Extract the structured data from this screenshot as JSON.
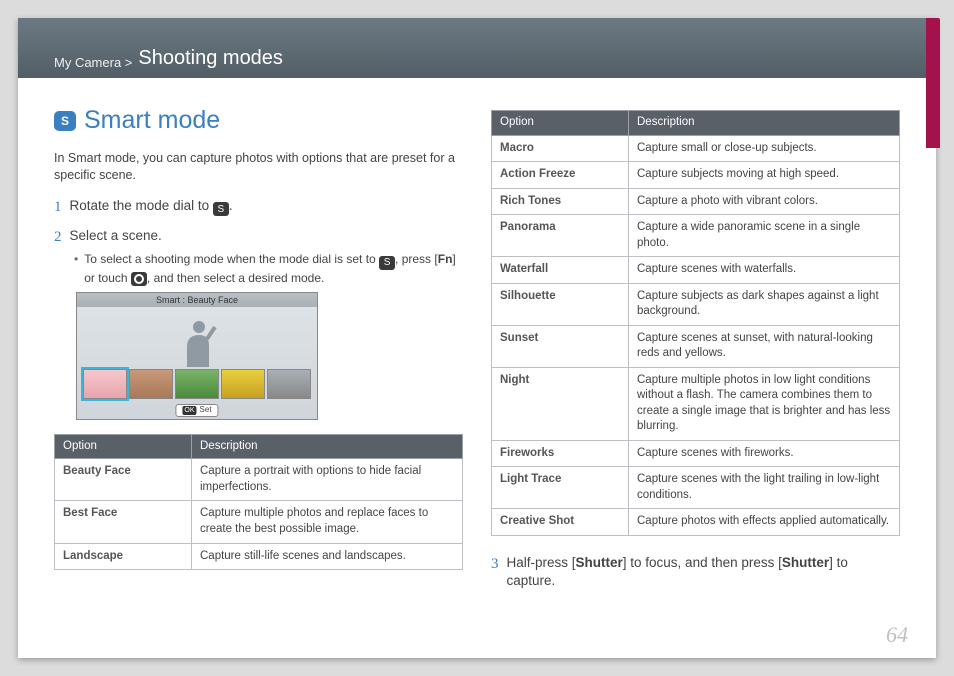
{
  "breadcrumb_prefix": "My Camera >",
  "breadcrumb_title": "Shooting modes",
  "section_title": "Smart mode",
  "section_icon_letter": "S",
  "intro": "In Smart mode, you can capture photos with options that are preset for a specific scene.",
  "step1": {
    "num": "1",
    "text_a": "Rotate the mode dial to ",
    "text_b": "."
  },
  "step2": {
    "num": "2",
    "text": "Select a scene."
  },
  "step2_bullet_a": "To select a shooting mode when the mode dial is set to ",
  "step2_bullet_b": ", press [",
  "step2_bullet_fn": "Fn",
  "step2_bullet_c": "] or touch ",
  "step2_bullet_d": ", and then select a desired mode.",
  "screenshot": {
    "title": "Smart : Beauty Face",
    "ok": "OK",
    "set": "Set"
  },
  "table1": {
    "headers": [
      "Option",
      "Description"
    ],
    "rows": [
      [
        "Beauty Face",
        "Capture a portrait with options to hide facial imperfections."
      ],
      [
        "Best Face",
        "Capture multiple photos and replace faces to create the best possible image."
      ],
      [
        "Landscape",
        "Capture still-life scenes and landscapes."
      ]
    ]
  },
  "table2": {
    "headers": [
      "Option",
      "Description"
    ],
    "rows": [
      [
        "Macro",
        "Capture small or close-up subjects."
      ],
      [
        "Action Freeze",
        "Capture subjects moving at high speed."
      ],
      [
        "Rich Tones",
        "Capture a photo with vibrant colors."
      ],
      [
        "Panorama",
        "Capture a wide panoramic scene in a single photo."
      ],
      [
        "Waterfall",
        "Capture scenes with waterfalls."
      ],
      [
        "Silhouette",
        "Capture subjects as dark shapes against a light background."
      ],
      [
        "Sunset",
        "Capture scenes at sunset, with natural-looking reds and yellows."
      ],
      [
        "Night",
        "Capture multiple photos in low light conditions without a flash. The camera combines them to create a single image that is brighter and has less blurring."
      ],
      [
        "Fireworks",
        "Capture scenes with fireworks."
      ],
      [
        "Light Trace",
        "Capture scenes with the light trailing in low-light conditions."
      ],
      [
        "Creative Shot",
        "Capture photos with effects applied automatically."
      ]
    ]
  },
  "step3": {
    "num": "3",
    "a": "Half-press [",
    "b": "Shutter",
    "c": "] to focus, and then press [",
    "d": "Shutter",
    "e": "] to capture."
  },
  "page_number": "64"
}
